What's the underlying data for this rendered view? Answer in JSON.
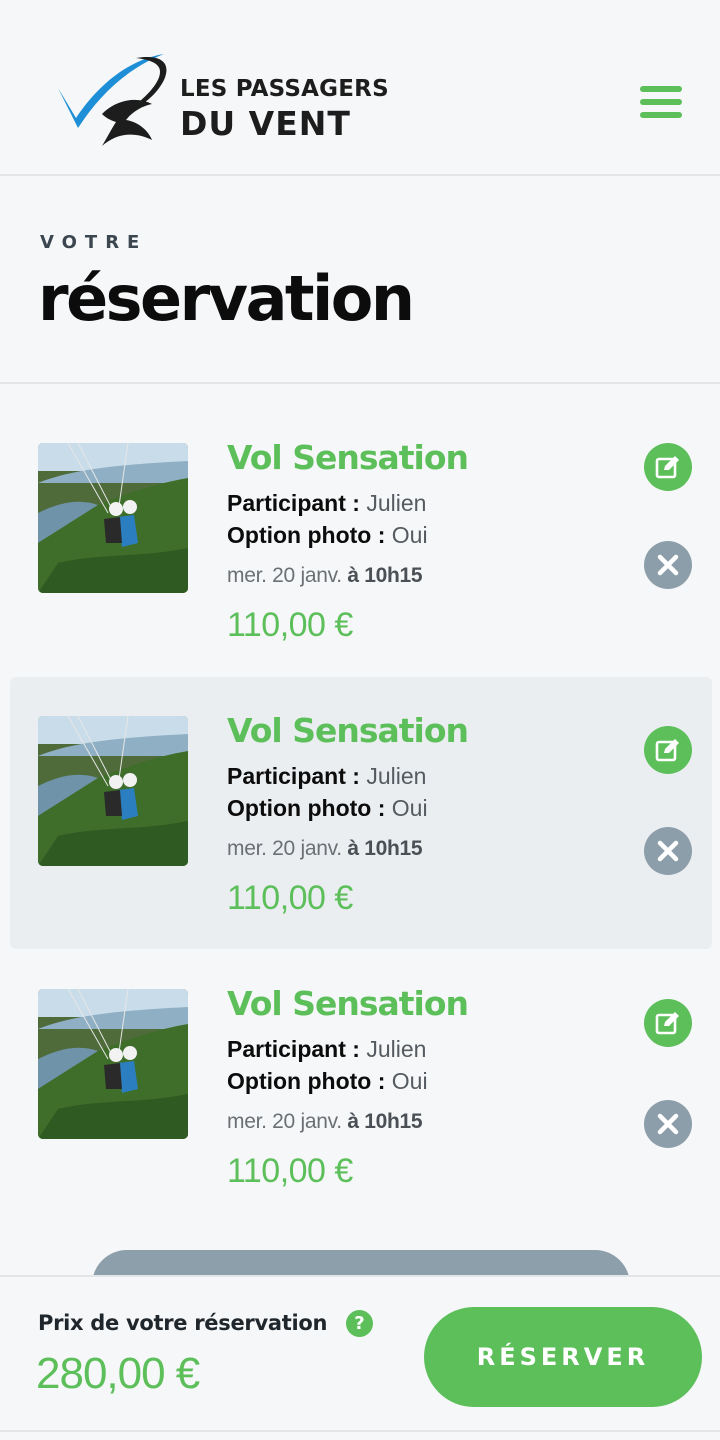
{
  "brand": {
    "line1": "LES PASSAGERS",
    "line2": "DU VENT",
    "colors": {
      "green": "#5cbf5a",
      "blue": "#1e8fd6",
      "grey": "#8d9eab"
    }
  },
  "menu": {
    "icon": "hamburger-menu-icon"
  },
  "heading": {
    "kicker": "VOTRE",
    "title": "réservation"
  },
  "items": [
    {
      "title": "Vol Sensation",
      "participant_label": "Participant :",
      "participant_value": "Julien",
      "photo_label": "Option photo :",
      "photo_value": "Oui",
      "date": "mer. 20 janv.",
      "time": "à 10h15",
      "price": "110,00 €",
      "image": "paragliding-tandem-photo",
      "edit_icon": "edit-icon",
      "delete_icon": "close-icon"
    },
    {
      "title": "Vol Sensation",
      "participant_label": "Participant :",
      "participant_value": "Julien",
      "photo_label": "Option photo :",
      "photo_value": "Oui",
      "date": "mer. 20 janv.",
      "time": "à 10h15",
      "price": "110,00 €",
      "image": "paragliding-tandem-photo",
      "edit_icon": "edit-icon",
      "delete_icon": "close-icon"
    },
    {
      "title": "Vol Sensation",
      "participant_label": "Participant :",
      "participant_value": "Julien",
      "photo_label": "Option photo :",
      "photo_value": "Oui",
      "date": "mer. 20 janv.",
      "time": "à 10h15",
      "price": "110,00 €",
      "image": "paragliding-tandem-photo",
      "edit_icon": "edit-icon",
      "delete_icon": "close-icon"
    }
  ],
  "footer": {
    "price_label": "Prix de votre réservation",
    "help_symbol": "?",
    "total": "280,00 €",
    "reserve_label": "RÉSERVER"
  }
}
